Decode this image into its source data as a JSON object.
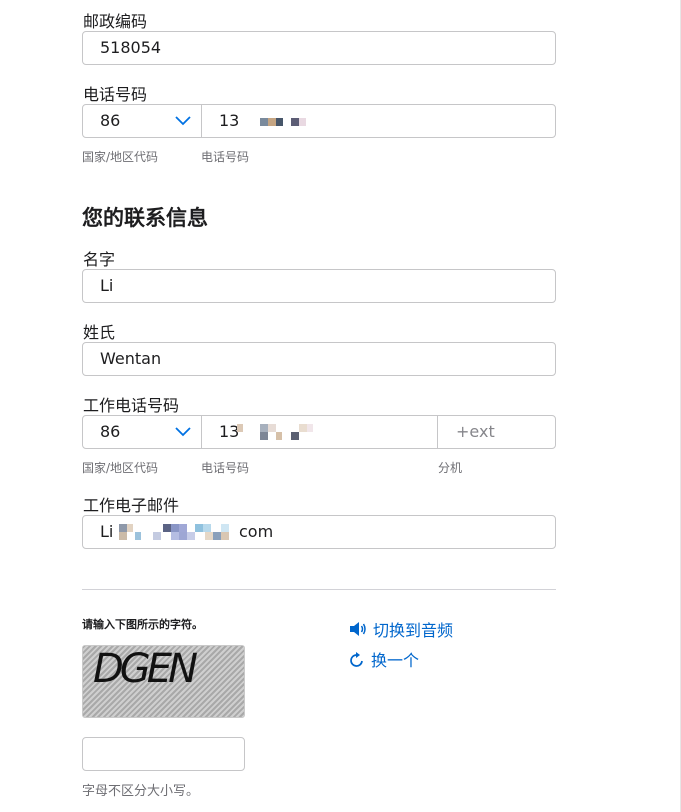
{
  "postal": {
    "label": "邮政编码",
    "value": "518054"
  },
  "phone": {
    "label": "电话号码",
    "country_code": "86",
    "number_visible": "13",
    "country_caption": "国家/地区代码",
    "number_caption": "电话号码"
  },
  "contact": {
    "heading": "您的联系信息",
    "first_name": {
      "label": "名字",
      "value": "Li"
    },
    "last_name": {
      "label": "姓氏",
      "value": "Wentan"
    },
    "work_phone": {
      "label": "工作电话号码",
      "country_code": "86",
      "number_visible": "13",
      "ext_placeholder": "+ext",
      "country_caption": "国家/地区代码",
      "number_caption": "电话号码",
      "ext_caption": "分机"
    },
    "work_email": {
      "label": "工作电子邮件",
      "value_prefix": "Li",
      "value_suffix": "com"
    }
  },
  "captcha": {
    "instruction": "请输入下图所示的字符。",
    "image_text": "DGEN",
    "audio_label": "切换到音频",
    "refresh_label": "换一个",
    "input_value": "",
    "case_note": "字母不区分大小写。"
  },
  "colors": {
    "link": "#0066cc",
    "chevron": "#0071e3",
    "border": "#c6c6c8"
  },
  "icons": {
    "dropdown": "chevron-down-icon",
    "audio": "speaker-icon",
    "refresh": "refresh-icon"
  }
}
